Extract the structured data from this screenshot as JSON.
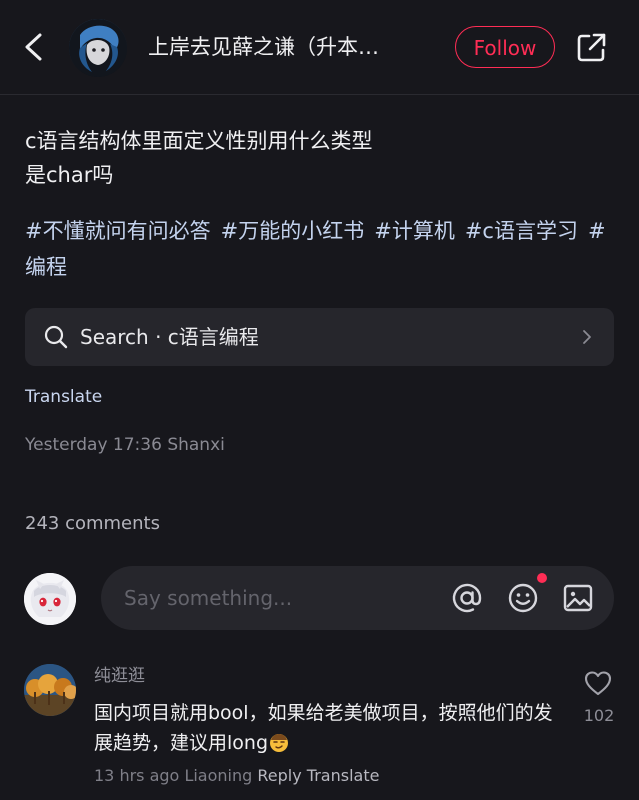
{
  "header": {
    "username": "上岸去见薛之谦（升本…",
    "follow_label": "Follow"
  },
  "post": {
    "body_lines": [
      "c语言结构体里面定义性别用什么类型",
      "是char吗"
    ],
    "tags": [
      "#不懂就问有问必答",
      "#万能的小红书",
      "#计算机",
      "#c语言学习",
      "#编程"
    ]
  },
  "search": {
    "label": "Search · c语言编程"
  },
  "translate_label": "Translate",
  "meta": {
    "time": "Yesterday 17:36",
    "location": "Shanxi"
  },
  "comments_count": "243 comments",
  "comment_input": {
    "placeholder": "Say something..."
  },
  "comment": {
    "author": "纯逛逛",
    "text": "国内项目就用bool，如果给老美做项目，按照他们的发展趋势，建议用long",
    "time": "13 hrs ago",
    "location": "Liaoning",
    "reply_label": "Reply",
    "translate_label": "Translate",
    "likes": "102"
  },
  "colors": {
    "background": "#17171c",
    "accent": "#ff2d55",
    "hashtag": "#c4d3ee",
    "muted": "#8a8a93"
  },
  "icons": [
    "back-arrow-icon",
    "share-icon",
    "search-icon",
    "chevron-right-icon",
    "at-icon",
    "emoji-icon",
    "image-icon",
    "heart-icon"
  ]
}
